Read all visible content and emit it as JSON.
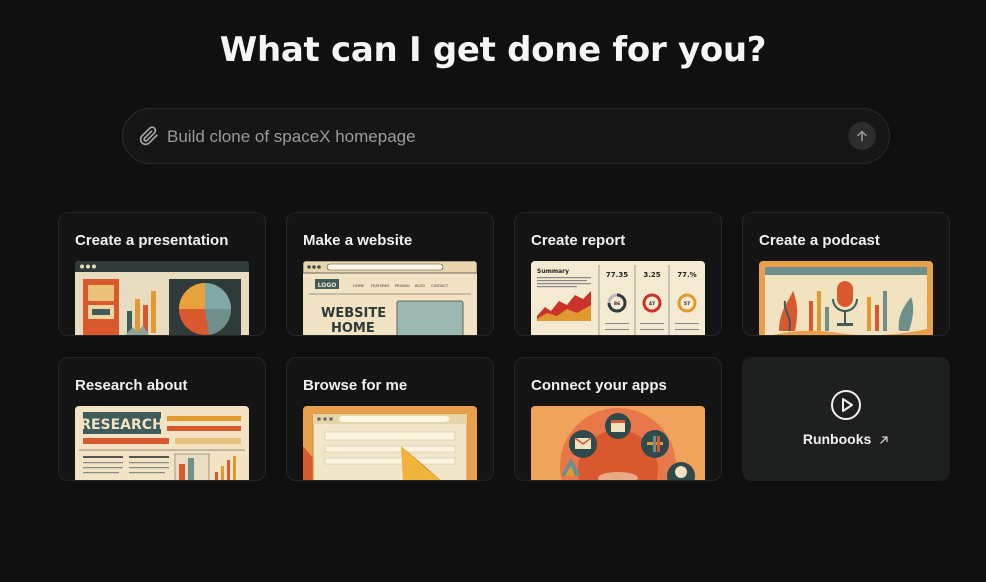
{
  "heading": "What can I get done for you?",
  "search": {
    "value": "",
    "placeholder": "Build clone of spaceX homepage"
  },
  "cards": [
    {
      "label": "Create a presentation",
      "icon": "presentation-thumbnail"
    },
    {
      "label": "Make a website",
      "icon": "website-thumbnail",
      "thumb_text": {
        "logo": "LOGO",
        "nav": [
          "HOME",
          "FEATURES",
          "PRICING",
          "BLOG",
          "CONTACT"
        ],
        "hero_line1": "WEBSITE",
        "hero_line2": "HOME"
      }
    },
    {
      "label": "Create report",
      "icon": "report-thumbnail",
      "thumb_text": {
        "summary": "Summary",
        "stats": [
          "77.35",
          "3.25",
          "77.%"
        ],
        "gauges": [
          "86",
          "47",
          "57"
        ]
      }
    },
    {
      "label": "Create a podcast",
      "icon": "podcast-thumbnail"
    },
    {
      "label": "Research about",
      "icon": "research-thumbnail",
      "thumb_text": {
        "banner": "RESEARCH"
      }
    },
    {
      "label": "Browse for me",
      "icon": "browser-thumbnail"
    },
    {
      "label": "Connect your apps",
      "icon": "apps-thumbnail"
    }
  ],
  "runbooks": {
    "label": "Runbooks",
    "icon": "play-circle-icon"
  },
  "colors": {
    "background": "#101010",
    "card": "#141414",
    "card_border": "#262626",
    "runbooks_bg": "#1e1f1f"
  }
}
